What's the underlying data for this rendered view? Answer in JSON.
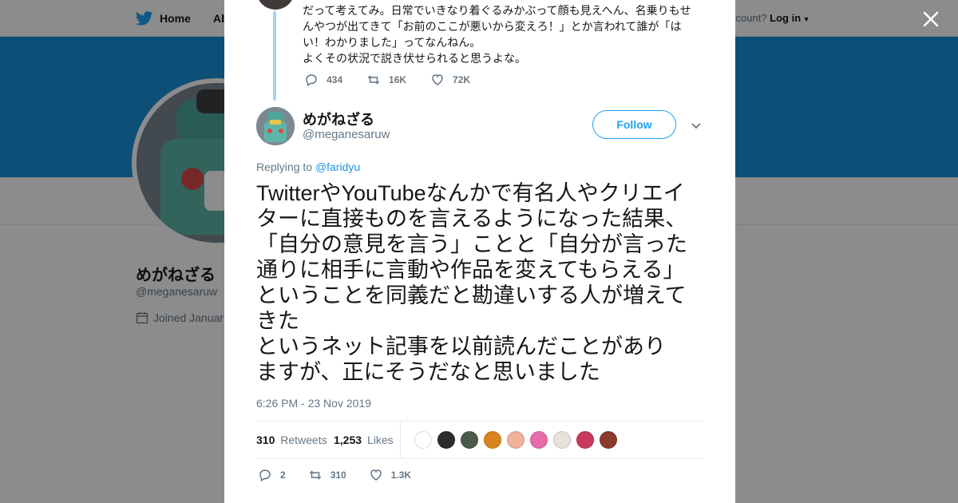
{
  "background": {
    "nav": {
      "home_label": "Home",
      "about_label": "Abo",
      "have_account": "ccount?",
      "login_label": "Log in"
    },
    "profile": {
      "name": "めがねざる",
      "handle": "@meganesaruw",
      "joined": "Joined Januar"
    }
  },
  "context_tweet": {
    "text": "だって考えてみ。日常でいきなり着ぐるみかぶって顔も見えへん、名乗りもせ\nんやつが出てきて「お前のここが悪いから変えろ！」とか言われて誰が「は\nい！わかりました」ってなんねん。\nよくその状況で説き伏せられると思うよな。",
    "replies": "434",
    "retweets": "16K",
    "likes": "72K"
  },
  "tweet": {
    "author_name": "めがねざる",
    "author_handle": "@meganesaruw",
    "follow_label": "Follow",
    "replying_prefix": "Replying to",
    "replying_to": "@faridyu",
    "text": "TwitterやYouTubeなんかで有名人やクリエイ\nターに直接ものを言えるようになった結果、\n「自分の意見を言う」ことと「自分が言った\n通りに相手に言動や作品を変えてもらえる」\nということを同義だと勘違いする人が増えて\nきた\nというネット記事を以前読んだことがあり\nますが、正にそうだなと思いました",
    "timestamp": "6:26 PM - 23 Nov 2019",
    "retweet_count": "310",
    "retweets_label": "Retweets",
    "like_count": "1,253",
    "likes_label": "Likes",
    "likers": [
      {
        "color": "#ffffff"
      },
      {
        "color": "#2b2b2b"
      },
      {
        "color": "#4a5a4a"
      },
      {
        "color": "#d9821e"
      },
      {
        "color": "#f0b39a"
      },
      {
        "color": "#e86aa8"
      },
      {
        "color": "#e8e2dc"
      },
      {
        "color": "#c9385a"
      },
      {
        "color": "#8a3a2a"
      }
    ],
    "actions": {
      "replies": "2",
      "retweets": "310",
      "likes": "1.3K"
    }
  },
  "colors": {
    "accent": "#1da1f2",
    "banner": "#1a91da",
    "thread_line": "#a7d3f0",
    "text_secondary": "#657786"
  }
}
